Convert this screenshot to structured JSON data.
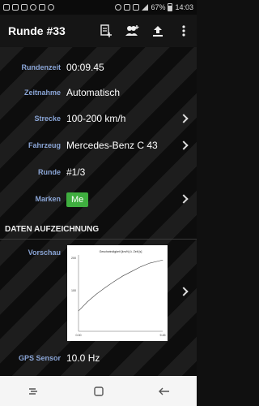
{
  "status": {
    "battery_pct": "67%",
    "time": "14:03"
  },
  "appbar": {
    "title": "Runde #33",
    "actions": [
      "note-add-icon",
      "group-add-icon",
      "share-upload-icon",
      "overflow-menu-icon"
    ]
  },
  "details": {
    "rundenzeit": {
      "label": "Rundenzeit",
      "value": "00:09.45"
    },
    "zeitnahme": {
      "label": "Zeitnahme",
      "value": "Automatisch"
    },
    "strecke": {
      "label": "Strecke",
      "value": "100-200 km/h"
    },
    "fahrzeug": {
      "label": "Fahrzeug",
      "value": "Mercedes-Benz C 43"
    },
    "runde": {
      "label": "Runde",
      "value": "#1/3"
    },
    "marken": {
      "label": "Marken",
      "value": "Me"
    }
  },
  "section": {
    "title": "DATEN AUFZEICHNUNG"
  },
  "preview": {
    "label": "Vorschau",
    "chart_title": "Geschwindigkeit [km/h] ü. Zeit [s]",
    "y_ticks": [
      "200",
      "100"
    ],
    "x_ticks": [
      "0.00",
      "9.45"
    ]
  },
  "gps": {
    "label": "GPS Sensor",
    "value": "10.0 Hz"
  },
  "colors": {
    "label_blue": "#8aa5d6",
    "badge_green": "#3fae3f"
  },
  "chart_data": {
    "type": "line",
    "title": "Geschwindigkeit [km/h] ü. Zeit [s]",
    "x": [
      0.0,
      1.0,
      2.0,
      3.0,
      4.0,
      5.0,
      6.0,
      7.0,
      8.0,
      9.45
    ],
    "series": [
      {
        "values": [
          100,
          118,
          133,
          146,
          158,
          169,
          178,
          187,
          194,
          200
        ]
      }
    ],
    "xlim": [
      0,
      9.45
    ],
    "ylim": [
      60,
      210
    ],
    "grid": false
  }
}
